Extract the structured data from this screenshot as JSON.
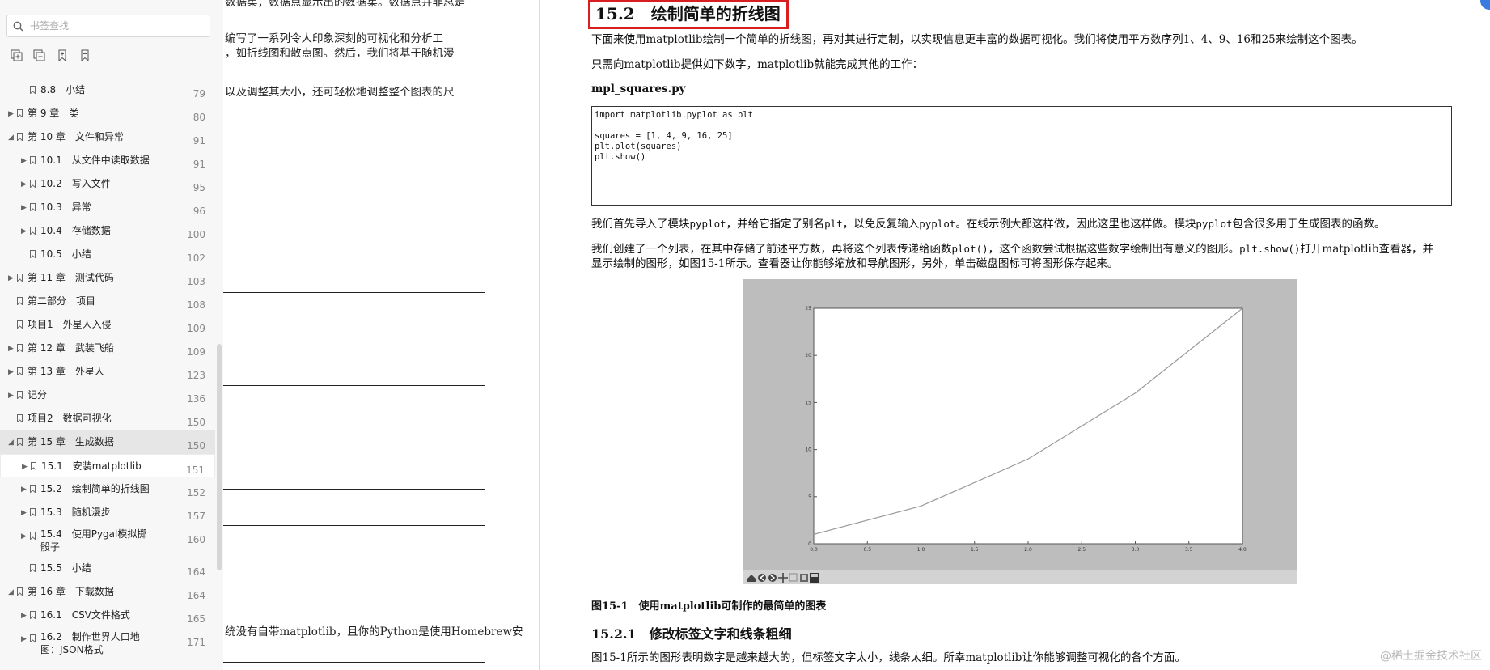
{
  "sidebar": {
    "search_placeholder": "书签查找",
    "toolbar_icons": [
      "expand-all-icon",
      "collapse-all-icon",
      "add-bookmark-icon",
      "remove-bookmark-icon"
    ],
    "items": [
      {
        "level": 2,
        "expand": false,
        "label": "8.8　小结",
        "page": "79"
      },
      {
        "level": 1,
        "expand": true,
        "label": "第 9 章　类",
        "page": "80"
      },
      {
        "level": 1,
        "expand": true,
        "expanded": true,
        "label": "第 10 章　文件和异常",
        "page": "91"
      },
      {
        "level": 2,
        "expand": true,
        "label": "10.1　从文件中读取数据",
        "page": "91"
      },
      {
        "level": 2,
        "expand": true,
        "label": "10.2　写入文件",
        "page": "95"
      },
      {
        "level": 2,
        "expand": true,
        "label": "10.3　异常",
        "page": "96"
      },
      {
        "level": 2,
        "expand": true,
        "label": "10.4　存储数据",
        "page": "100"
      },
      {
        "level": 2,
        "expand": false,
        "label": "10.5　小结",
        "page": "102"
      },
      {
        "level": 1,
        "expand": true,
        "label": "第 11 章　测试代码",
        "page": "103"
      },
      {
        "level": 1,
        "expand": false,
        "label": "第二部分　项目",
        "page": "108"
      },
      {
        "level": 1,
        "expand": false,
        "label": "项目1　外星人入侵",
        "page": "109"
      },
      {
        "level": 1,
        "expand": true,
        "label": "第 12 章　武装飞船",
        "page": "109"
      },
      {
        "level": 1,
        "expand": true,
        "label": "第 13 章　外星人",
        "page": "123"
      },
      {
        "level": 1,
        "expand": true,
        "label": "记分",
        "page": "136"
      },
      {
        "level": 1,
        "expand": false,
        "label": "项目2　数据可视化",
        "page": "150"
      },
      {
        "level": 1,
        "expand": true,
        "expanded": true,
        "selected": true,
        "label": "第 15 章　生成数据",
        "page": "150"
      },
      {
        "level": 2,
        "expand": true,
        "hovered": true,
        "label": "15.1　安装matplotlib",
        "page": "151"
      },
      {
        "level": 2,
        "expand": true,
        "label": "15.2　绘制简单的折线图",
        "page": "152"
      },
      {
        "level": 2,
        "expand": true,
        "label": "15.3　随机漫步",
        "page": "157"
      },
      {
        "level": 2,
        "expand": true,
        "tall": true,
        "label": "15.4　使用Pygal模拟掷骰子",
        "page": "160"
      },
      {
        "level": 2,
        "expand": false,
        "label": "15.5　小结",
        "page": "164"
      },
      {
        "level": 1,
        "expand": true,
        "expanded": true,
        "label": "第 16 章　下载数据",
        "page": "164"
      },
      {
        "level": 2,
        "expand": true,
        "label": "16.1　CSV文件格式",
        "page": "165"
      },
      {
        "level": 2,
        "expand": true,
        "tall": true,
        "label": "16.2　制作世界人口地图：JSON格式",
        "page": "171"
      }
    ]
  },
  "left_page": {
    "lines": [
      {
        "text": "数据集；数据点显示出的数据集。数据点并非总是",
        "top": -9
      },
      {
        "text": "编写了一系列令人印象深刻的可视化和分析工",
        "top": 36
      },
      {
        "text": "，如折线图和散点图。然后，我们将基于随机漫",
        "top": 54
      },
      {
        "text": "以及调整其大小，还可轻松地调整整个图表的尺",
        "top": 102
      },
      {
        "text": "统没有自带matplotlib，且你的Python是使用Homebrew安",
        "top": 769
      }
    ]
  },
  "right_page": {
    "section_title": "15.2　绘制简单的折线图",
    "p1": "下面来使用matplotlib绘制一个简单的折线图，再对其进行定制，以实现信息更丰富的数据可视化。我们将使用平方数序列1、4、9、16和25来绘制这个图表。",
    "p2": "只需向matplotlib提供如下数字，matplotlib就能完成其他的工作：",
    "filename": "mpl_squares.py",
    "code_lines": [
      "import matplotlib.pyplot as plt",
      "",
      "squares = [1, 4, 9, 16, 25]",
      "plt.plot(squares)",
      "plt.show()"
    ],
    "p3": {
      "a": "我们首先导入了模块",
      "b": "pyplot",
      "c": "，并给它指定了别名",
      "d": "plt",
      "e": "，以免反复输入",
      "f": "pyplot",
      "g": "。在线示例大都这样做，因此这里也这样做。模块",
      "h": "pyplot",
      "i": "包含很多用于生成图表的函数。"
    },
    "p4_1": {
      "a": "我们创建了一个列表，在其中存储了前述平方数，再将这个列表传递给函数",
      "b": "plot()",
      "c": "，这个函数尝试根据这些数字绘制出有意义的图形。",
      "d": "plt.show()",
      "e": "打开matplotlib查看器，并"
    },
    "p4_2": "显示绘制的图形，如图15-1所示。查看器让你能够缩放和导航图形，另外，单击磁盘图标可将图形保存起来。",
    "figure_caption": "图15-1　使用matplotlib可制作的最简单的图表",
    "subsection_title": "15.2.1　修改标签文字和线条粗细",
    "p5": "图15-1所示的图形表明数字是越来越大的，但标签文字太小，线条太细。所幸matplotlib让你能够调整可视化的各个方面。",
    "figure_toolbar_icons": [
      "home-icon",
      "back-icon",
      "forward-icon",
      "pan-icon",
      "zoom-icon",
      "subplots-icon",
      "save-icon"
    ]
  },
  "watermark": "@稀土掘金技术社区",
  "chart_data": {
    "type": "line",
    "x": [
      0,
      1,
      2,
      3,
      4
    ],
    "series": [
      {
        "values": [
          1,
          4,
          9,
          16,
          25
        ]
      }
    ],
    "x_ticks": [
      "0.0",
      "0.5",
      "1.0",
      "1.5",
      "2.0",
      "2.5",
      "3.0",
      "3.5",
      "4.0"
    ],
    "y_ticks": [
      "0",
      "5",
      "10",
      "15",
      "20",
      "25"
    ],
    "xlim": [
      0,
      4
    ],
    "ylim": [
      0,
      25
    ],
    "line_color": "#9a9a9a",
    "background": "#bdbdbd",
    "grid": false
  }
}
